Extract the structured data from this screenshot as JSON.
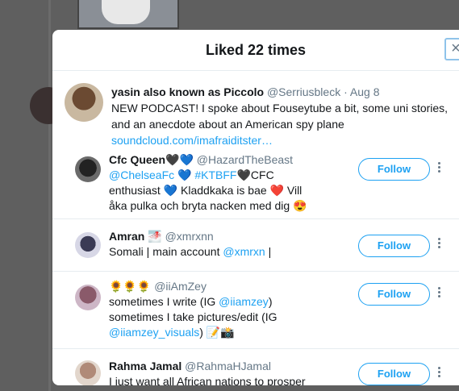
{
  "modal": {
    "title": "Liked 22 times",
    "close_label": "×"
  },
  "original_tweet": {
    "name": "yasin also known as Piccolo",
    "handle": "@Serriusbleck",
    "date": "· Aug 8",
    "text": "NEW PODCAST! I spoke about Fouseytube a bit, some uni stories, and an anecdote about an American spy plane",
    "link": "soundcloud.com/imafraiditster…"
  },
  "users": [
    {
      "name": "Cfc Queen",
      "name_emoji": "🖤💙",
      "handle": "@HazardTheBeast",
      "bio_line1_parts": [
        "@ChelseaFc",
        "💙",
        "#KTBFF",
        "🖤",
        "CFC"
      ],
      "bio_line2": "enthusiast 💙 Kladdkaka is bae ❤️ Vill",
      "bio_line3": "åka pulka och bryta nacken med dig 😍",
      "follow_label": "Follow"
    },
    {
      "name": "Amran",
      "name_emoji": "🌁",
      "handle": "@xmrxnn",
      "bio_prefix": "Somali | main account ",
      "bio_link": "@xmrxn",
      "bio_suffix": " |",
      "follow_label": "Follow"
    },
    {
      "name": "🌻🌻🌻",
      "handle": "@iiAmZey",
      "bio_line1_prefix": "sometimes I write (IG ",
      "bio_line1_link": "@iiamzey",
      "bio_line1_suffix": ")",
      "bio_line2": "sometimes I take pictures/edit (IG",
      "bio_line3_link": "@iiamzey_visuals",
      "bio_line3_suffix": ") 📝📸",
      "follow_label": "Follow"
    },
    {
      "name": "Rahma Jamal",
      "handle": "@RahmaHJamal",
      "bio_line1": "I just want all African nations to prosper",
      "follow_label": "Follow"
    }
  ],
  "colors": {
    "accent": "#1da1f2",
    "muted": "#657786",
    "text": "#14171a"
  }
}
